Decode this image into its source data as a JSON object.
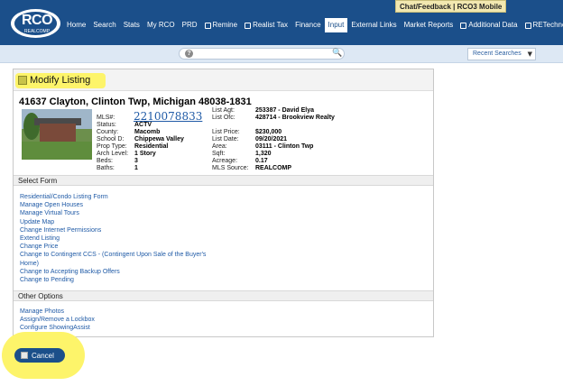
{
  "topbar": {
    "logo_text": "RCO",
    "logo_sub": "REALCOMP",
    "chat_label": "Chat/Feedback | RCO3 Mobile",
    "nav": [
      {
        "label": "Home",
        "icon": false
      },
      {
        "label": "Search",
        "icon": false
      },
      {
        "label": "Stats",
        "icon": false
      },
      {
        "label": "My RCO",
        "icon": false
      },
      {
        "label": "PRD",
        "icon": false
      },
      {
        "label": "Remine",
        "icon": true
      },
      {
        "label": "Realist Tax",
        "icon": true
      },
      {
        "label": "Finance",
        "icon": false
      },
      {
        "label": "Input",
        "icon": false,
        "active": true
      },
      {
        "label": "External Links",
        "icon": false
      },
      {
        "label": "Market Reports",
        "icon": false
      },
      {
        "label": "Additional Data",
        "icon": true
      },
      {
        "label": "RETechnology",
        "icon": true
      }
    ]
  },
  "search": {
    "recent_label": "Recent Searches"
  },
  "panel": {
    "title": "Modify Listing",
    "address": "41637 Clayton, Clinton Twp, Michigan 48038-1831",
    "mls_label": "MLS#:",
    "mls_number": "2210078833",
    "left_fields": [
      {
        "label": "Status:",
        "value": "ACTV"
      },
      {
        "label": "County:",
        "value": "Macomb"
      },
      {
        "label": "School D:",
        "value": "Chippewa Valley"
      },
      {
        "label": "Prop Type:",
        "value": "Residential"
      },
      {
        "label": "Arch Level:",
        "value": "1 Story"
      },
      {
        "label": "Beds:",
        "value": "3"
      },
      {
        "label": "Baths:",
        "value": "1"
      }
    ],
    "right_fields": [
      {
        "label": "List Agt:",
        "value": "253387 - David Elya"
      },
      {
        "label": "List Ofc:",
        "value": "428714 - Brookview Realty"
      },
      {
        "label": "List Price:",
        "value": "$230,000"
      },
      {
        "label": "List Date:",
        "value": "09/20/2021"
      },
      {
        "label": "Area:",
        "value": "03111 - Clinton Twp"
      },
      {
        "label": "Sqft:",
        "value": "1,320"
      },
      {
        "label": "Acreage:",
        "value": "0.17"
      },
      {
        "label": "MLS Source:",
        "value": "REALCOMP"
      }
    ],
    "select_form_header": "Select Form",
    "forms": [
      "Residential/Condo Listing Form",
      "Manage Open Houses",
      "Manage Virtual Tours",
      "Update Map",
      "Change Internet Permissions",
      "Extend Listing",
      "Change Price",
      "Change to Contingent CCS - (Contingent Upon Sale of the Buyer's",
      "Home)",
      "Change to Accepting Backup Offers",
      "Change to Pending"
    ],
    "other_options_header": "Other Options",
    "options": [
      "Manage Photos",
      "Assign/Remove a Lockbox",
      "Configure ShowingAssist"
    ]
  },
  "cancel_label": "Cancel"
}
